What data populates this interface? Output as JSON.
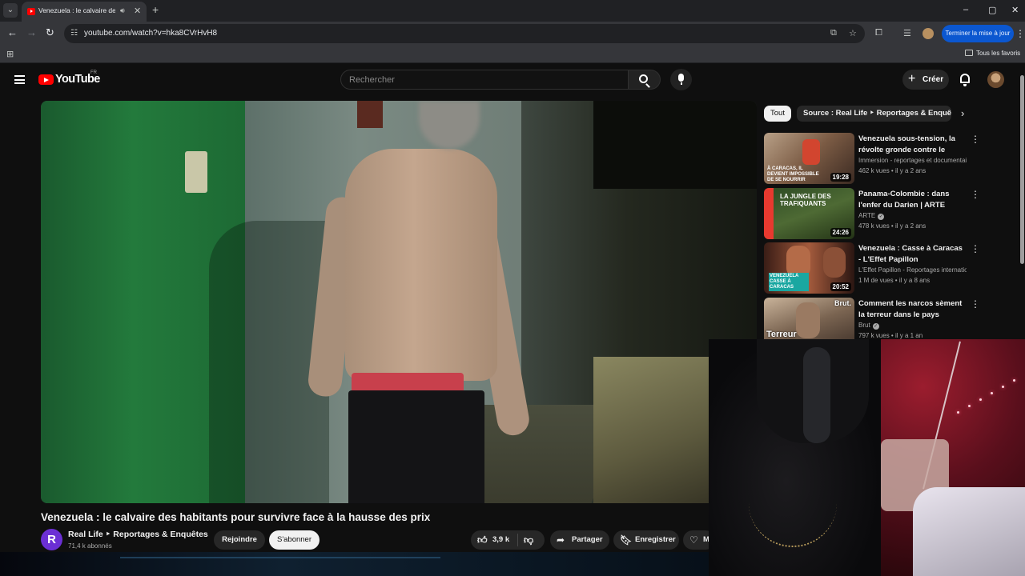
{
  "browser": {
    "tab_title": "Venezuela : le calvaire des h",
    "new_tab": "+",
    "url": "youtube.com/watch?v=hka8CVrHvH8",
    "update_label": "Terminer la mise à jour",
    "bookmarks_all": "Tous les favoris",
    "window_controls": {
      "minimize": "–",
      "maximize": "▢",
      "close": "✕"
    }
  },
  "header": {
    "logo_text": "YouTube",
    "country": "FR",
    "search_placeholder": "Rechercher",
    "create_label": "Créer"
  },
  "video": {
    "title": "Venezuela : le calvaire des habitants pour survivre face à la hausse des prix",
    "channel_initial": "R",
    "channel": "Real Life ‣ Reportages & Enquêtes",
    "subscribers": "71,4 k abonnés",
    "join_label": "Rejoindre",
    "subscribe_label": "S'abonner",
    "likes": "3,9 k",
    "share_label": "Partager",
    "save_label": "Enregistrer",
    "more_label": "M"
  },
  "chips": {
    "all": "Tout",
    "source": "Source : Real Life ‣ Reportages & Enquêtes"
  },
  "recommendations": [
    {
      "title": "Venezuela sous-tension, la révolte gronde contre le régim...",
      "channel": "Immersion - reportages et documentair...",
      "views": "462 k vues",
      "age": "il y a 2 ans",
      "duration": "19:28",
      "thumb_caption": "À CARACAS, IL DEVIENT IMPOSSIBLE DE SE NOURRIR",
      "verified": false
    },
    {
      "title": "Panama-Colombie : dans l'enfer du Darien | ARTE Reportage",
      "channel": "ARTE",
      "views": "478 k vues",
      "age": "il y a 2 ans",
      "duration": "24:26",
      "thumb_caption": "LA JUNGLE DES TRAFIQUANTS",
      "verified": true
    },
    {
      "title": "Venezuela : Casse à Caracas - L'Effet Papillon",
      "channel": "L'Effet Papillon - Reportages internationa...",
      "views": "1 M de vues",
      "age": "il y a 8 ans",
      "duration": "20:52",
      "thumb_caption": "VENEZUELA CASSE À CARACAS",
      "verified": false
    },
    {
      "title": "Comment les narcos sèment la terreur dans le pays",
      "channel": "Brut",
      "views": "797 k vues",
      "age": "il y a 1 an",
      "duration": "",
      "thumb_caption": "Terreur",
      "thumb_badge": "Brut.",
      "verified": true
    }
  ],
  "colors": {
    "yt_red": "#ff0000",
    "chrome_dark": "#202124",
    "chrome_toolbar": "#35363a",
    "update_blue": "#0b57d0",
    "page_bg": "#0f0f0f"
  }
}
